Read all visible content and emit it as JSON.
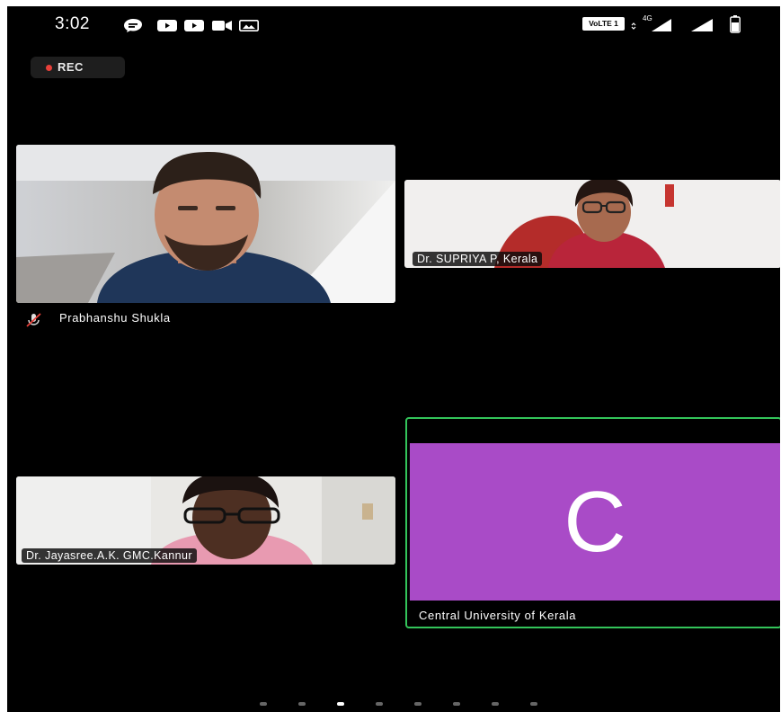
{
  "status_bar": {
    "time": "3:02",
    "left_icons": [
      "chat-bubble-icon",
      "youtube-icon",
      "youtube-icon",
      "video-camera-icon",
      "gallery-icon"
    ],
    "volte_label": "VoLTE 1",
    "network_label": "4G",
    "right_icons": [
      "signal-icon",
      "signal-icon",
      "battery-icon"
    ]
  },
  "recording": {
    "label": "REC",
    "color": "#e8403a"
  },
  "participants": [
    {
      "name": "Prabhanshu Shukla",
      "muted": true,
      "tile": "video"
    },
    {
      "name": "Dr. SUPRIYA P, Kerala",
      "tile": "video"
    },
    {
      "name": "Dr. Jayasree.A.K. GMC.Kannur",
      "tile": "video"
    },
    {
      "name": "Central University of Kerala",
      "initial": "C",
      "avatar_color": "#a94bc7",
      "active_speaker": true,
      "active_border_color": "#33c45a",
      "tile": "avatar"
    }
  ],
  "pagination": {
    "pages": 8,
    "current": 3
  }
}
